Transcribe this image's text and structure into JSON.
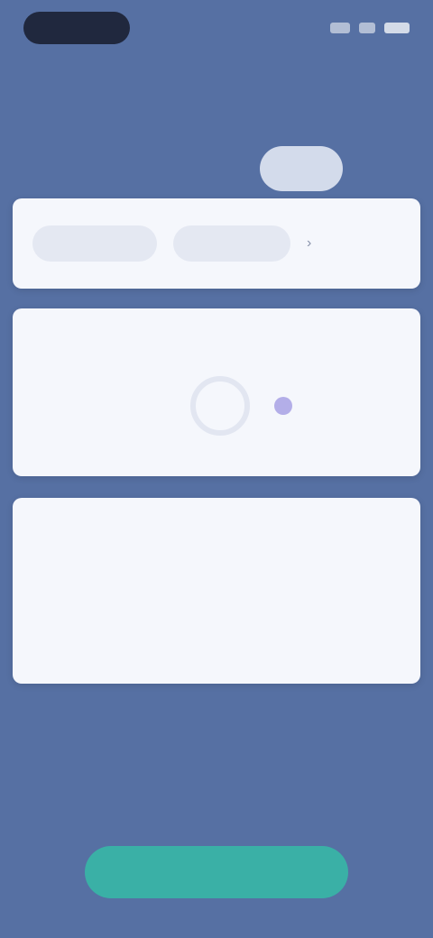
{
  "status_bar": {
    "left_pill": "",
    "icons": [
      "signal-icon",
      "wifi-icon",
      "battery-icon"
    ]
  },
  "header": {
    "eyebrow": "",
    "title": "",
    "subtitle": "",
    "badge": ""
  },
  "card1": {
    "chip_a": "",
    "chip_b": "",
    "chevron": "›"
  },
  "card2": {
    "label": "",
    "caption": ""
  },
  "card3": {
    "label": "",
    "row1": {
      "label": "",
      "value": ""
    },
    "row2": {
      "label": "",
      "mid": "",
      "value": ""
    }
  },
  "primary_button": {
    "label": ""
  },
  "colors": {
    "background": "#5670a3",
    "card": "#f5f7fc",
    "accent": "#3ab0a6",
    "pill": "#20283e"
  }
}
